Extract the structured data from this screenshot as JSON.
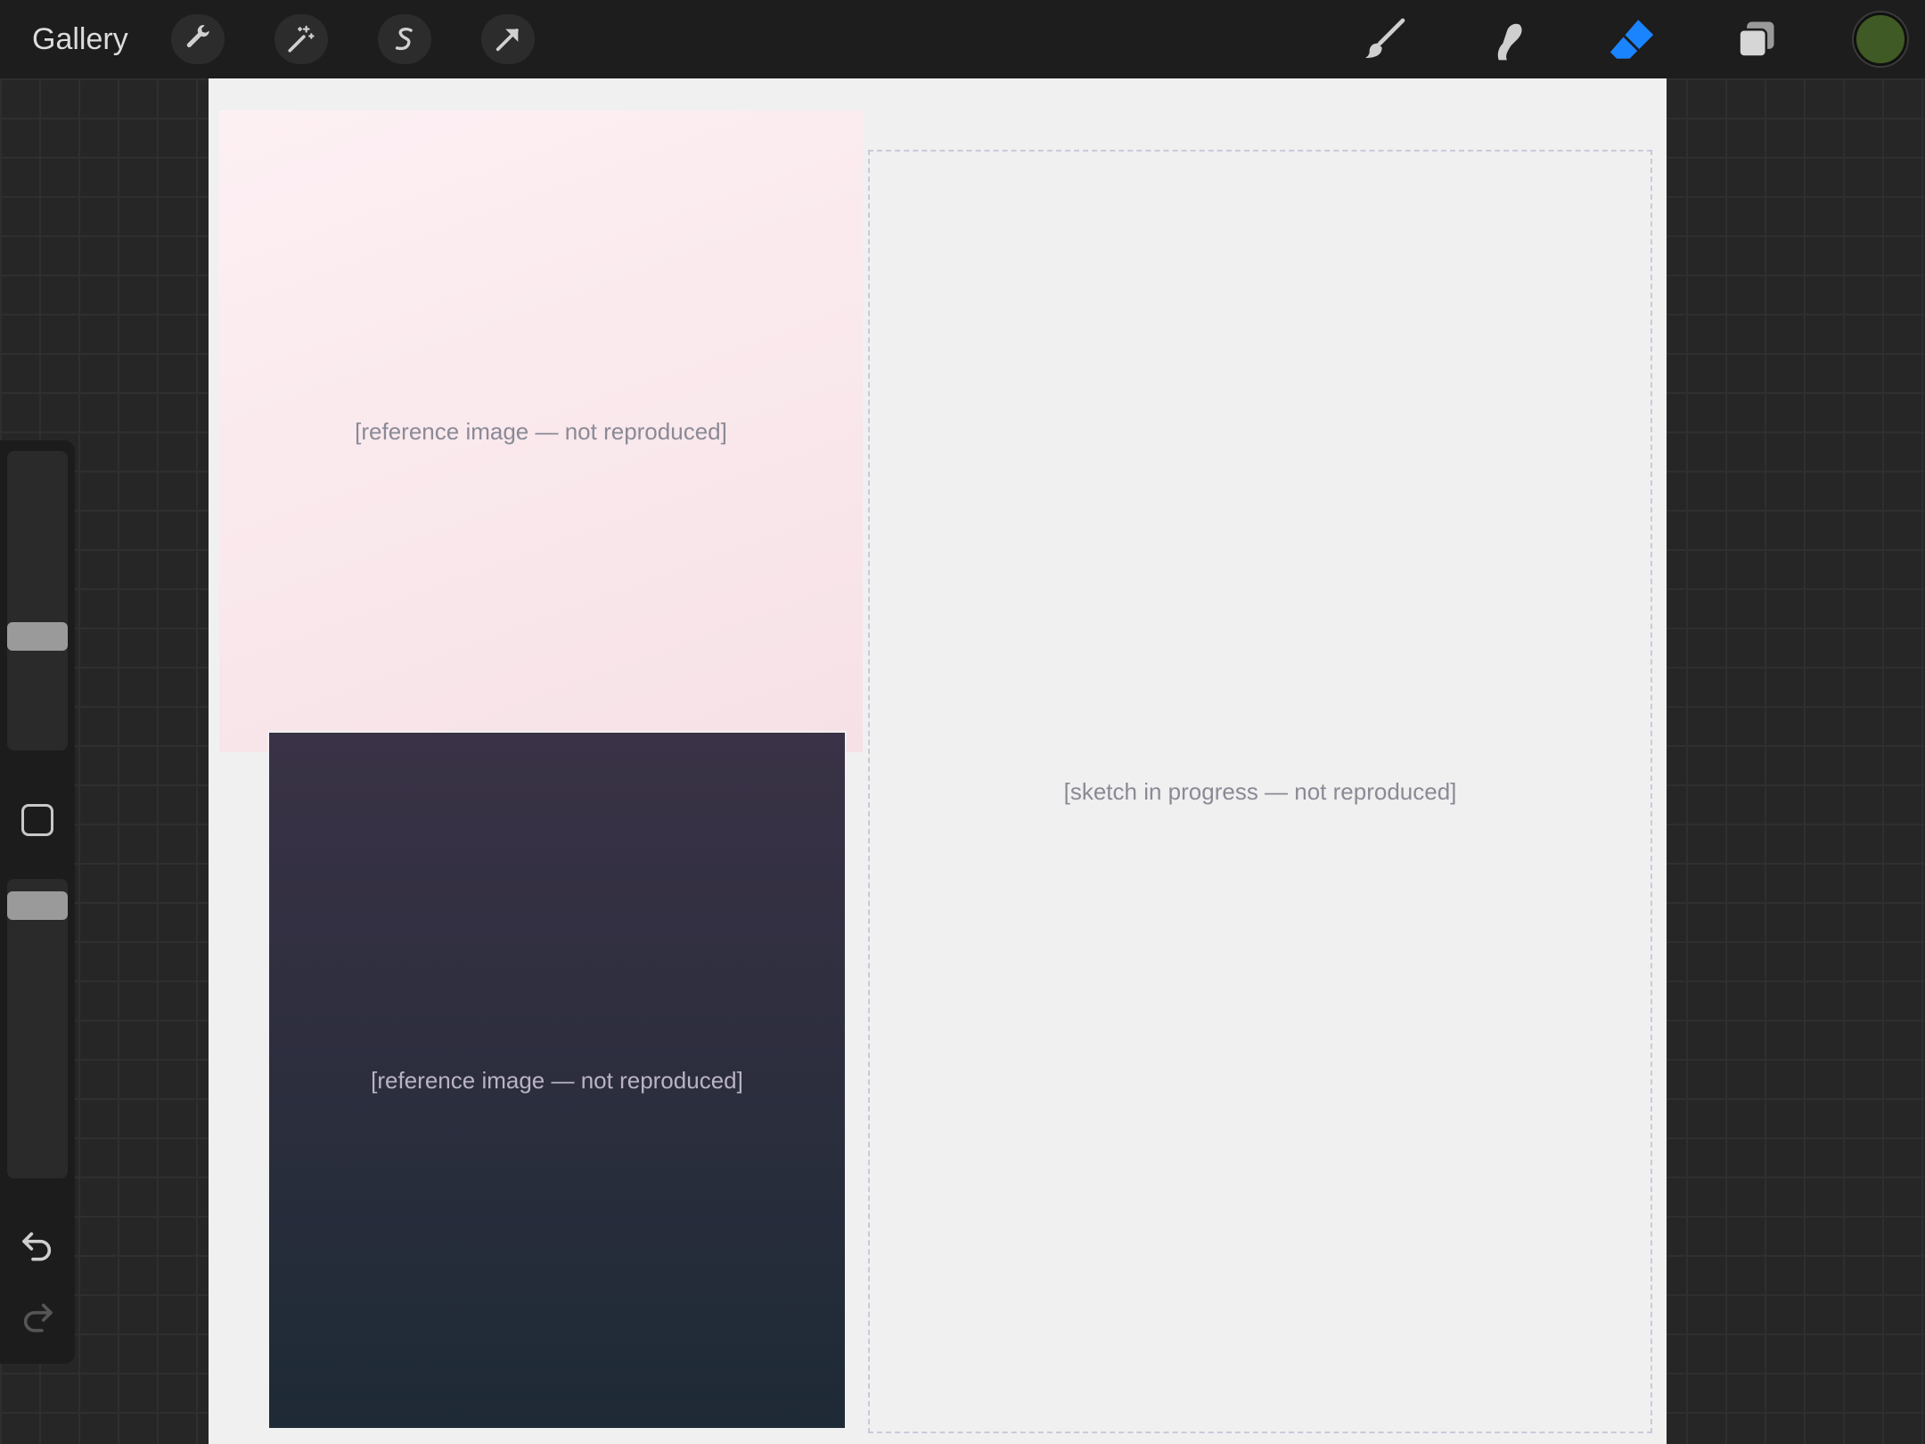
{
  "topbar": {
    "gallery_label": "Gallery",
    "left_tools": [
      "wrench-icon",
      "magic-wand-icon",
      "selection-icon",
      "transform-arrow-icon"
    ],
    "right_tools": [
      "brush-icon",
      "smudge-icon",
      "eraser-icon",
      "layers-icon"
    ],
    "active_tool": "eraser",
    "active_color": "#3f5a24",
    "accent_color": "#1a84ff"
  },
  "sidebar": {
    "brush_size_level": 0.6,
    "opacity_level": 0.3,
    "items": [
      "brush-size-slider",
      "modify-button",
      "opacity-slider",
      "undo-icon",
      "redo-icon"
    ]
  },
  "canvas": {
    "background_color": "#f0f0f0",
    "notes": {
      "ref_a": "[reference image — not reproduced]",
      "ref_b": "[reference image — not reproduced]",
      "sketch": "[sketch in progress — not reproduced]"
    }
  }
}
